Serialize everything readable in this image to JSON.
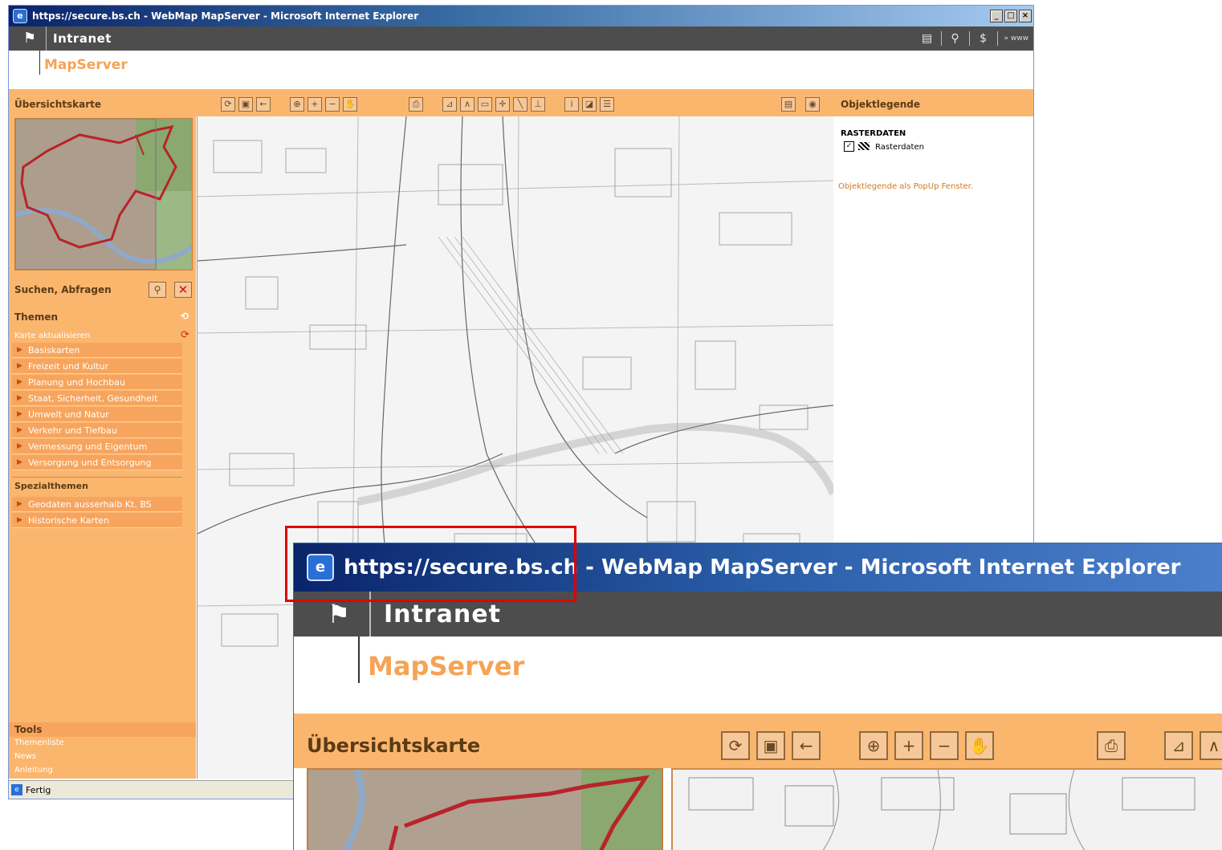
{
  "window": {
    "title": "https://secure.bs.ch - WebMap MapServer - Microsoft Internet Explorer",
    "controls": {
      "minimize": "_",
      "maximize": "□",
      "close": "×"
    }
  },
  "header": {
    "site": "Intranet",
    "www": "» www"
  },
  "app": {
    "title": "MapServer"
  },
  "left": {
    "overview_title": "Übersichtskarte",
    "search_title": "Suchen, Abfragen",
    "themes_title": "Themen",
    "refresh_link": "Karte aktualisieren",
    "themes": [
      "Basiskarten",
      "Freizeit und Kultur",
      "Planung und Hochbau",
      "Staat, Sicherheit, Gesundheit",
      "Umwelt und Natur",
      "Verkehr und Tiefbau",
      "Vermessung und Eigentum",
      "Versorgung und Entsorgung"
    ],
    "special_title": "Spezialthemen",
    "special": [
      "Geodaten ausserhalb Kt. BS",
      "Historische Karten"
    ],
    "tools_title": "Tools",
    "tools": [
      "Themenliste",
      "News",
      "Anleitung"
    ]
  },
  "legend": {
    "title": "Objektlegende",
    "group": "RASTERDATEN",
    "item": "Rasterdaten",
    "popup_link": "Objektlegende als PopUp Fenster."
  },
  "status": {
    "text": "Fertig"
  },
  "zoom": {
    "title": "https://secure.bs.ch - WebMap MapServer - Microsoft Internet Explorer",
    "site": "Intranet",
    "app": "MapServer",
    "overview_title": "Übersichtskarte"
  }
}
